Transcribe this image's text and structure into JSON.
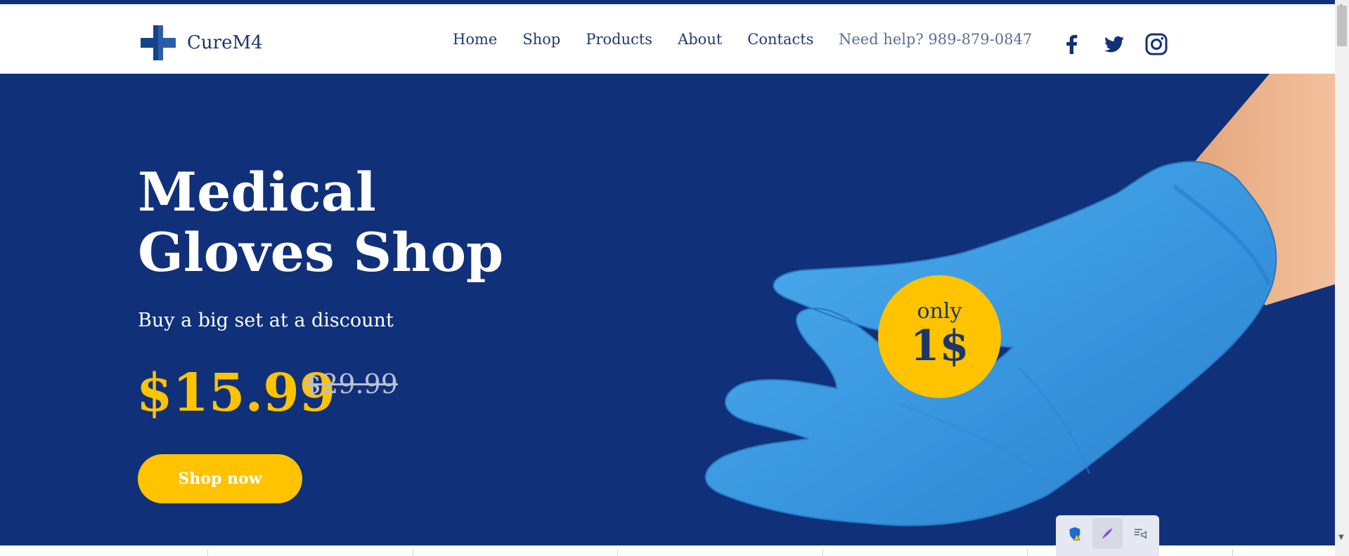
{
  "brand": {
    "name": "CureM4",
    "logo_icon": "medical-cross-icon",
    "color": "#10307a"
  },
  "nav": {
    "items": [
      {
        "label": "Home"
      },
      {
        "label": "Shop"
      },
      {
        "label": "Products"
      },
      {
        "label": "About"
      },
      {
        "label": "Contacts"
      }
    ]
  },
  "help": {
    "text": "Need help? 989-879-0847"
  },
  "social": {
    "icons": [
      "facebook-icon",
      "twitter-icon",
      "instagram-icon"
    ]
  },
  "hero": {
    "title_line1": "Medical",
    "title_line2": "Gloves Shop",
    "subtitle": "Buy a big set at a discount",
    "price": "$15.99",
    "old_price": "$29.99",
    "button": "Shop now",
    "badge_top": "only",
    "badge_main": "1$",
    "background": "#10307a",
    "accent": "#ffc300"
  },
  "tray": {
    "icons": [
      "shield-warning-icon",
      "feather-icon",
      "list-speaker-icon"
    ]
  }
}
